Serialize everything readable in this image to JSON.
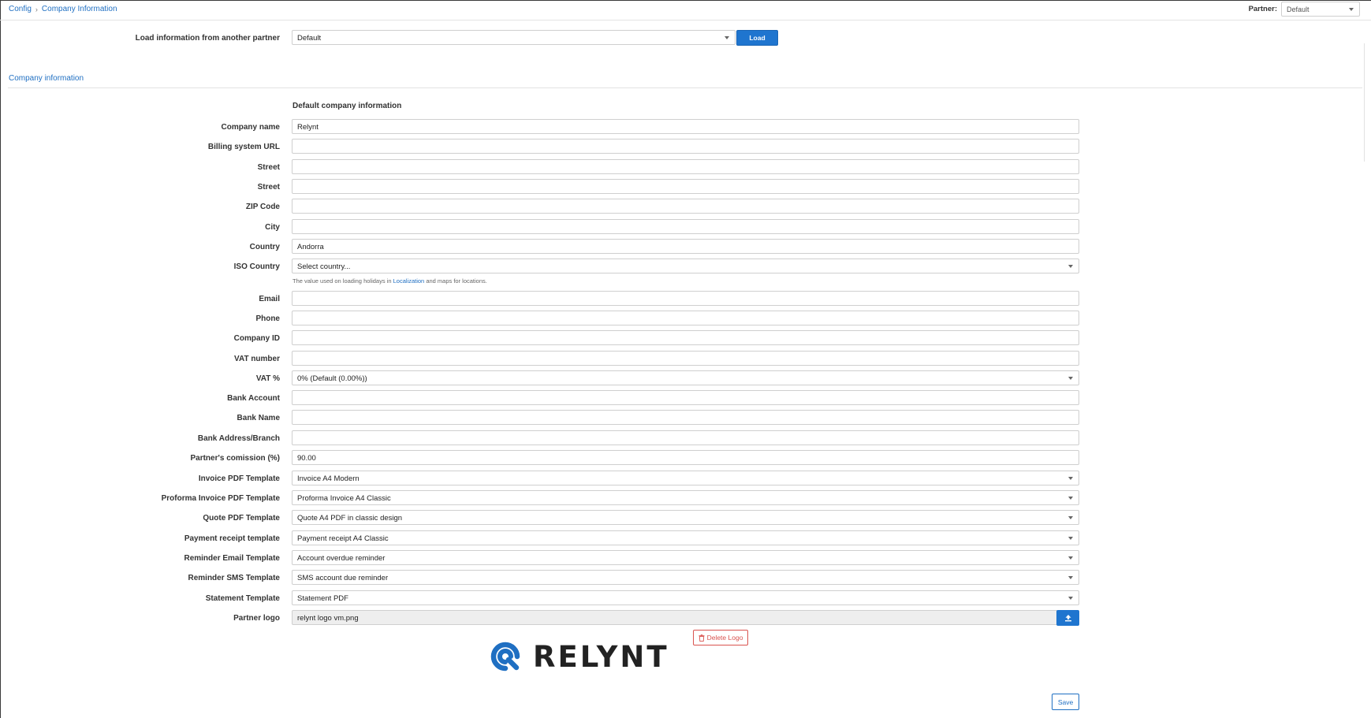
{
  "breadcrumb": {
    "root": "Config",
    "current": "Company Information"
  },
  "partner": {
    "label": "Partner:",
    "value": "Default"
  },
  "load": {
    "label": "Load information from another partner",
    "value": "Default",
    "button": "Load"
  },
  "section": {
    "title": "Company information",
    "subheading": "Default company information"
  },
  "fields": {
    "company_name": {
      "label": "Company name",
      "value": "Relynt"
    },
    "billing_url": {
      "label": "Billing system URL",
      "value": ""
    },
    "street1": {
      "label": "Street",
      "value": ""
    },
    "street2": {
      "label": "Street",
      "value": ""
    },
    "zip": {
      "label": "ZIP Code",
      "value": ""
    },
    "city": {
      "label": "City",
      "value": ""
    },
    "country": {
      "label": "Country",
      "value": "Andorra"
    },
    "iso_country": {
      "label": "ISO Country",
      "value": "Select country..."
    },
    "email": {
      "label": "Email",
      "value": ""
    },
    "phone": {
      "label": "Phone",
      "value": ""
    },
    "company_id": {
      "label": "Company ID",
      "value": ""
    },
    "vat_number": {
      "label": "VAT number",
      "value": ""
    },
    "vat_percent": {
      "label": "VAT %",
      "value": "0% (Default (0.00%))"
    },
    "bank_account": {
      "label": "Bank Account",
      "value": ""
    },
    "bank_name": {
      "label": "Bank Name",
      "value": ""
    },
    "bank_address": {
      "label": "Bank Address/Branch",
      "value": ""
    },
    "partner_commission": {
      "label": "Partner's comission (%)",
      "value": "90.00"
    },
    "invoice_pdf": {
      "label": "Invoice PDF Template",
      "value": "Invoice A4 Modern"
    },
    "proforma_pdf": {
      "label": "Proforma Invoice PDF Template",
      "value": "Proforma Invoice A4 Classic"
    },
    "quote_pdf": {
      "label": "Quote PDF Template",
      "value": "Quote A4 PDF in classic design"
    },
    "payment_receipt": {
      "label": "Payment receipt template",
      "value": "Payment receipt A4 Classic"
    },
    "reminder_email": {
      "label": "Reminder Email Template",
      "value": "Account overdue reminder"
    },
    "reminder_sms": {
      "label": "Reminder SMS Template",
      "value": "SMS account due reminder"
    },
    "statement": {
      "label": "Statement Template",
      "value": "Statement PDF"
    },
    "partner_logo": {
      "label": "Partner logo",
      "value": "relynt logo vm.png"
    }
  },
  "help": {
    "before": "The value used on loading holidays in",
    "link": "Localization",
    "after": "and maps for locations."
  },
  "logo_actions": {
    "delete": "Delete Logo"
  },
  "logo": {
    "text": "RELYNT",
    "color": "#1f6fc2"
  },
  "save": "Save",
  "icons": {
    "caret": "chevron-down-icon",
    "upload": "upload-icon",
    "trash": "trash-icon"
  }
}
